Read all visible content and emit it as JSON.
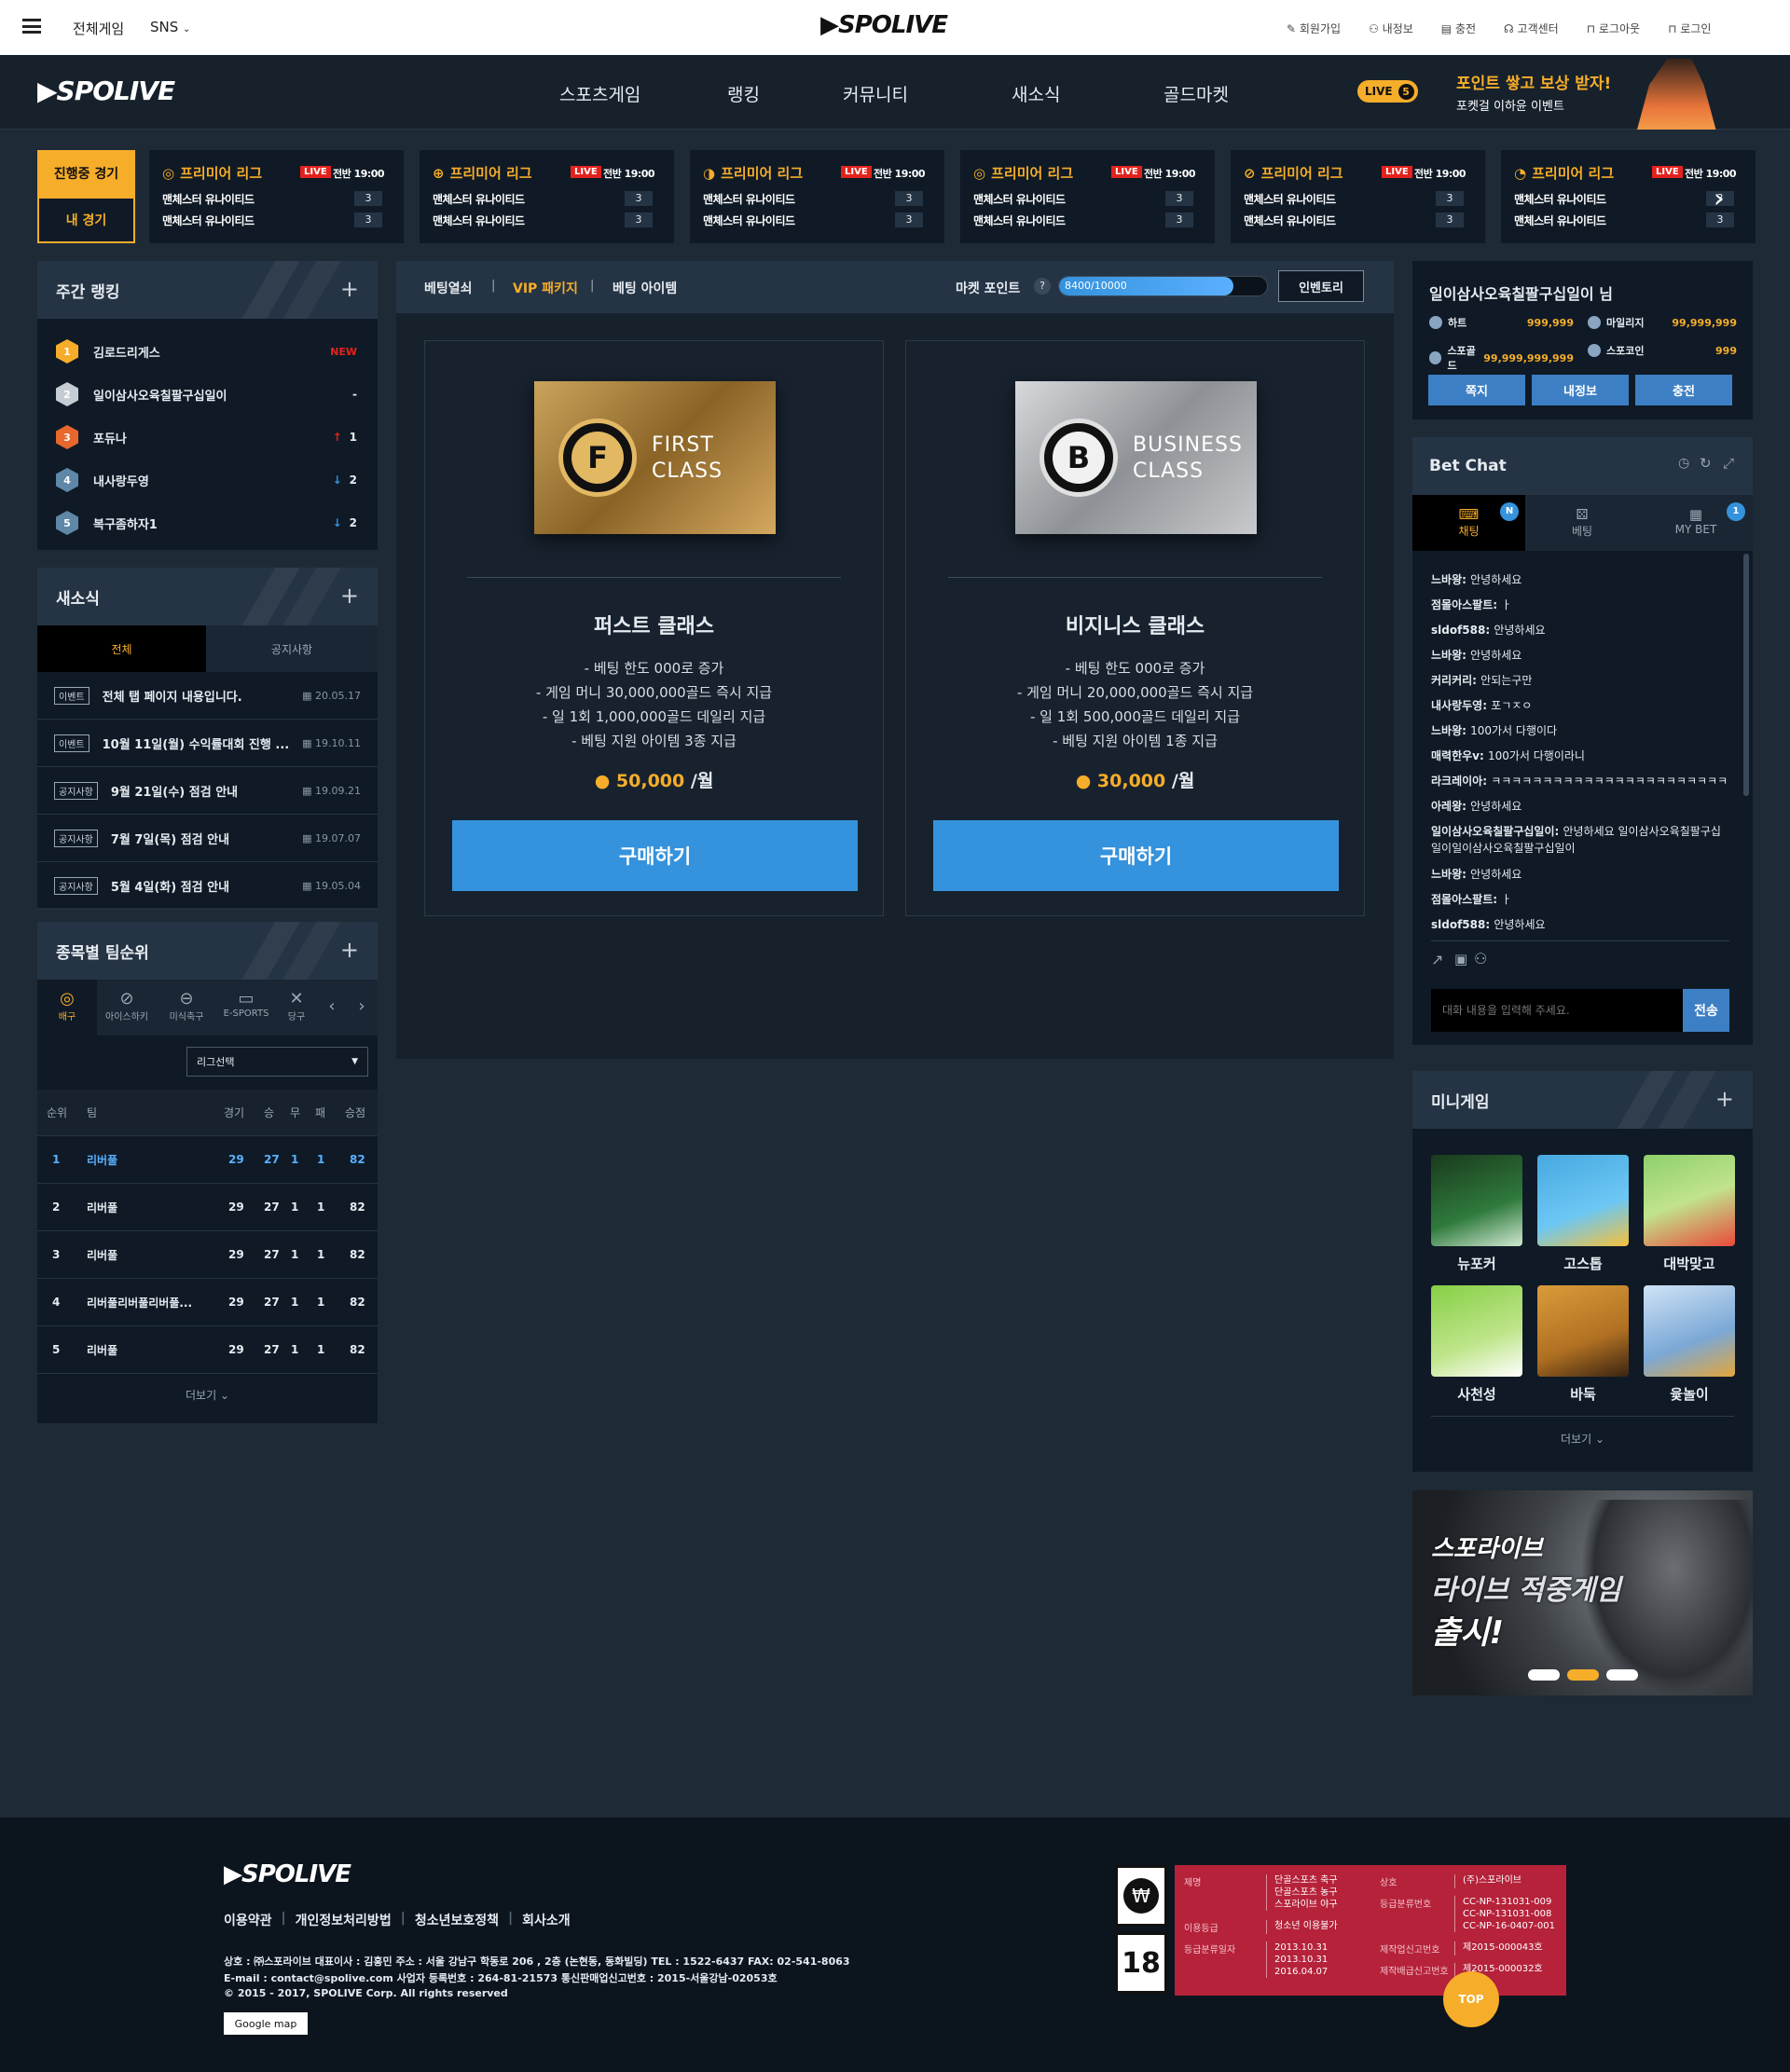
{
  "topbar": {
    "menu_label": "전체게임",
    "sns_label": "SNS",
    "logo": "SPOLIVE",
    "links": [
      "회원가입",
      "내정보",
      "충전",
      "고객센터",
      "로그아웃",
      "로그인"
    ]
  },
  "nav": {
    "logo": "SPOLIVE",
    "items": [
      "스포츠게임",
      "랭킹",
      "커뮤니티",
      "새소식",
      "골드마켓"
    ],
    "live_badge": "LIVE",
    "live_count": "5",
    "promo_title": "포인트 쌓고 보상 받자!",
    "promo_sub": "포켓걸 이하윤 이벤트"
  },
  "match_tabs": {
    "active": "진행중 경기",
    "mine": "내 경기"
  },
  "matches": [
    {
      "league": "프리미어 리그",
      "live": "LIVE",
      "time": "전반 19:00",
      "home": "맨체스터 유나이티드",
      "away": "맨체스터 유나이티드",
      "home_score": "3",
      "away_score": "3"
    },
    {
      "league": "프리미어 리그",
      "live": "LIVE",
      "time": "전반 19:00",
      "home": "맨체스터 유나이티드",
      "away": "맨체스터 유나이티드",
      "home_score": "3",
      "away_score": "3"
    },
    {
      "league": "프리미어 리그",
      "live": "LIVE",
      "time": "전반 19:00",
      "home": "맨체스터 유나이티드",
      "away": "맨체스터 유나이티드",
      "home_score": "3",
      "away_score": "3"
    },
    {
      "league": "프리미어 리그",
      "live": "LIVE",
      "time": "전반 19:00",
      "home": "맨체스터 유나이티드",
      "away": "맨체스터 유나이티드",
      "home_score": "3",
      "away_score": "3"
    },
    {
      "league": "프리미어 리그",
      "live": "LIVE",
      "time": "전반 19:00",
      "home": "맨체스터 유나이티드",
      "away": "맨체스터 유나이티드",
      "home_score": "3",
      "away_score": "3"
    },
    {
      "league": "프리미어 리그",
      "live": "LIVE",
      "time": "전반 19:00",
      "home": "맨체스터 유나이티드",
      "away": "맨체스터 유나이티드",
      "home_score": "3",
      "away_score": "3"
    }
  ],
  "weekly_rank": {
    "title": "주간 랭킹",
    "rows": [
      {
        "rank": "1",
        "name": "김로드리게스",
        "change": "NEW",
        "dir": "new"
      },
      {
        "rank": "2",
        "name": "일이삼사오육칠팔구십일이",
        "change": "-",
        "dir": "same"
      },
      {
        "rank": "3",
        "name": "포듀나",
        "change": "1",
        "dir": "up"
      },
      {
        "rank": "4",
        "name": "내사랑두영",
        "change": "2",
        "dir": "down"
      },
      {
        "rank": "5",
        "name": "복구좀하자1",
        "change": "2",
        "dir": "down"
      }
    ]
  },
  "news": {
    "title": "새소식",
    "tabs": [
      "전체",
      "공지사항"
    ],
    "rows": [
      {
        "tag": "이벤트",
        "text": "전체 탭 페이지 내용입니다.",
        "date": "20.05.17"
      },
      {
        "tag": "이벤트",
        "text": "10월 11일(월) 수익률대회 진행 ...",
        "date": "19.10.11"
      },
      {
        "tag": "공지사항",
        "text": "9월 21일(수) 점검 안내",
        "date": "19.09.21"
      },
      {
        "tag": "공지사항",
        "text": "7월 7일(목) 점검 안내",
        "date": "19.07.07"
      },
      {
        "tag": "공지사항",
        "text": "5월 4일(화) 점검 안내",
        "date": "19.05.04"
      }
    ]
  },
  "team_rank": {
    "title": "종목별 팀순위",
    "sports": [
      "배구",
      "아이스하키",
      "미식축구",
      "E-SPORTS",
      "당구"
    ],
    "select": "리그선택",
    "headers": [
      "순위",
      "팀",
      "경기",
      "승",
      "무",
      "패",
      "승점"
    ],
    "rows": [
      [
        "1",
        "리버풀",
        "29",
        "27",
        "1",
        "1",
        "82"
      ],
      [
        "2",
        "리버풀",
        "29",
        "27",
        "1",
        "1",
        "82"
      ],
      [
        "3",
        "리버풀",
        "29",
        "27",
        "1",
        "1",
        "82"
      ],
      [
        "4",
        "리버풀리버풀리버풀...",
        "29",
        "27",
        "1",
        "1",
        "82"
      ],
      [
        "5",
        "리버풀",
        "29",
        "27",
        "1",
        "1",
        "82"
      ]
    ],
    "more": "더보기"
  },
  "market": {
    "tabs": [
      "베팅열쇠",
      "VIP 패키지",
      "베팅 아이템"
    ],
    "point_label": "마켓 포인트",
    "point_help": "?",
    "point_value": "8400/10000",
    "point_progress": 0.84,
    "inventory": "인벤토리",
    "cards": [
      {
        "card_line1": "FIRST",
        "card_line2": "CLASS",
        "letter": "F",
        "name": "퍼스트 클래스",
        "features": [
          "- 베팅 한도 000로 증가",
          "- 게임 머니 30,000,000골드 즉시 지급",
          "- 일 1회 1,000,000골드 데일리 지급",
          "- 베팅 지원 아이템 3종 지급"
        ],
        "price": "50,000",
        "unit": "/월",
        "buy": "구매하기"
      },
      {
        "card_line1": "BUSINESS",
        "card_line2": "CLASS",
        "letter": "B",
        "name": "비지니스 클래스",
        "features": [
          "- 베팅 한도 000로 증가",
          "- 게임 머니 20,000,000골드 즉시 지급",
          "- 일 1회 500,000골드 데일리 지급",
          "- 베팅 지원 아이템 1종 지급"
        ],
        "price": "30,000",
        "unit": "/월",
        "buy": "구매하기"
      }
    ]
  },
  "user": {
    "name": "일이삼사오육칠팔구십일이 님",
    "stats": [
      {
        "label": "하트",
        "value": "999,999"
      },
      {
        "label": "마일리지",
        "value": "99,999,999"
      },
      {
        "label": "스포골드",
        "value": "99,999,999,999"
      },
      {
        "label": "스포코인",
        "value": "999"
      }
    ],
    "buttons": [
      "쪽지",
      "내정보",
      "충전"
    ]
  },
  "chat": {
    "title": "Bet Chat",
    "tabs": [
      {
        "label": "채팅",
        "badge": "N"
      },
      {
        "label": "베팅",
        "badge": ""
      },
      {
        "label": "MY BET",
        "badge": "1"
      }
    ],
    "messages": [
      {
        "user": "느바왕",
        "text": "안녕하세요"
      },
      {
        "user": "점몰아스팔트",
        "text": "ㅏ"
      },
      {
        "user": "sldof588",
        "text": "안녕하세요"
      },
      {
        "user": "느바왕",
        "text": "안녕하세요"
      },
      {
        "user": "커리커리",
        "text": "안되는구만"
      },
      {
        "user": "내사랑두영",
        "text": "포ㄱㅈㅇ"
      },
      {
        "user": "느바왕",
        "text": "100가서 다행이다"
      },
      {
        "user": "매력한우v",
        "text": "100가서 다행이라니"
      },
      {
        "user": "라크레이아",
        "text": "ㅋㅋㅋㅋㅋㅋㅋㅋㅋㅋㅋㅋㅋㅋㅋㅋㅋㅋㅋㅋㅋㅋㅋㅋ"
      },
      {
        "user": "아레왕",
        "text": "안녕하세요"
      },
      {
        "user": "일이삼사오육칠팔구십일이",
        "text": "안녕하세요 일이삼사오육칠팔구십일이일이삼사오육칠팔구십일이"
      },
      {
        "user": "느바왕",
        "text": "안녕하세요"
      },
      {
        "user": "점몰아스팔트",
        "text": "ㅏ"
      },
      {
        "user": "sldof588",
        "text": "안녕하세요"
      }
    ],
    "input_placeholder": "대화 내용을 입력해 주세요.",
    "send": "전송"
  },
  "minigame": {
    "title": "미니게임",
    "games": [
      "뉴포커",
      "고스톱",
      "대박맞고",
      "사천성",
      "바둑",
      "윷놀이"
    ],
    "more": "더보기"
  },
  "banner": {
    "line1": "스포라이브",
    "line2": "라이브 적중게임",
    "line3": "출시!"
  },
  "footer": {
    "logo": "SPOLIVE",
    "links": [
      "이용약관",
      "개인정보처리방법",
      "청소년보호정책",
      "회사소개"
    ],
    "info1": "상호 : ㈜스포라이브 대표이사 : 김홍민 주소 : 서울 강남구 학동로 206 , 2층 (논현동, 동화빌딩) TEL : 1522-6437 FAX: 02-541-8063",
    "info2": "E-mail : contact@spolive.com 사업자 등록번호 : 264-81-21573 통신판매업신고번호 : 2015-서울강남-02053호",
    "copy": "© 2015 - 2017, SPOLIVE Corp. All rights reserved",
    "google_map": "Google map",
    "rating_left": [
      {
        "k": "제명",
        "v": "단골스포츠 축구\n단골스포츠 농구\n스포라이브 야구"
      },
      {
        "k": "이용등급",
        "v": "청소년 이용불가"
      },
      {
        "k": "등급분류일자",
        "v": "2013.10.31\n2013.10.31\n2016.04.07"
      }
    ],
    "rating_right": [
      {
        "k": "상호",
        "v": "(주)스포라이브"
      },
      {
        "k": "등급분류번호",
        "v": "CC-NP-131031-009\nCC-NP-131031-008\nCC-NP-16-0407-001"
      },
      {
        "k": "제작업신고번호",
        "v": "제2015-000043호"
      },
      {
        "k": "제작배급신고번호",
        "v": "제2015-000032호"
      }
    ],
    "top": "TOP"
  },
  "colors": {
    "accent": "#f6ad2a",
    "blue": "#3592dc",
    "live": "#e4221d"
  }
}
